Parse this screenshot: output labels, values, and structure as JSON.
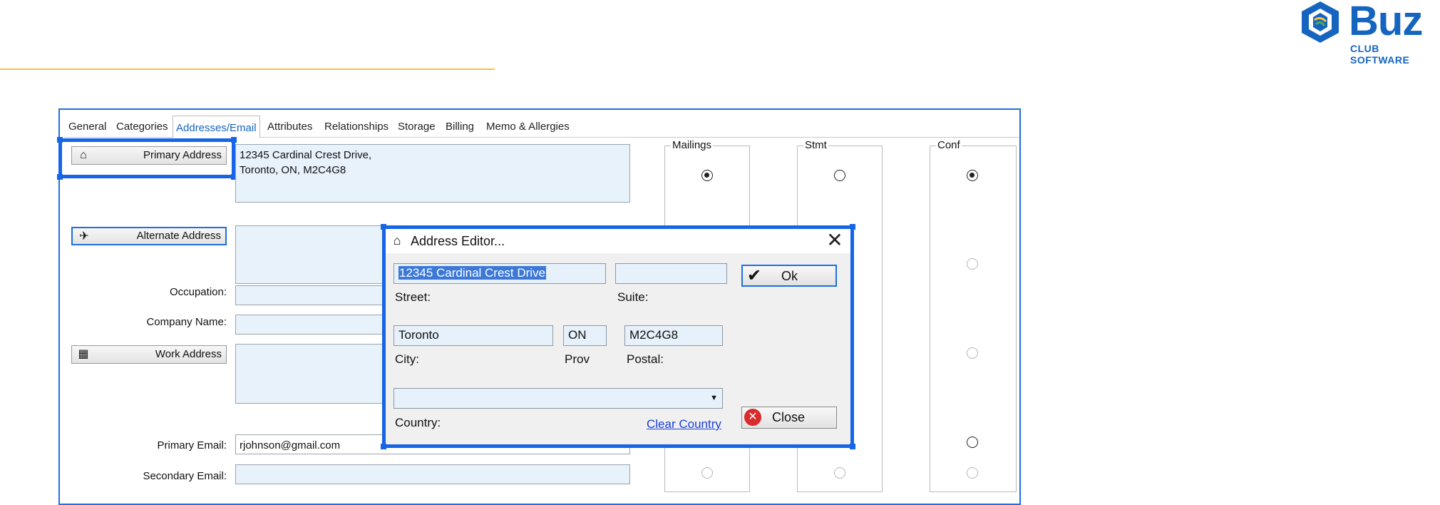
{
  "brand": {
    "logo_text": "Buz",
    "logo_subtext": "CLUB SOFTWARE",
    "accent_color": "#1565c0",
    "rule_color": "#f5c242"
  },
  "tabs": [
    {
      "label": "General"
    },
    {
      "label": "Categories"
    },
    {
      "label": "Addresses/Email",
      "active": true
    },
    {
      "label": "Attributes"
    },
    {
      "label": "Relationships"
    },
    {
      "label": "Storage"
    },
    {
      "label": "Billing"
    },
    {
      "label": "Memo & Allergies"
    }
  ],
  "form": {
    "primary_address_button": "Primary Address",
    "primary_address_line1": "12345 Cardinal Crest Drive,",
    "primary_address_line2": "Toronto, ON, M2C4G8",
    "alternate_address_button": "Alternate Address",
    "occupation_label": "Occupation:",
    "company_name_label": "Company Name:",
    "work_address_button": "Work Address",
    "primary_email_label": "Primary Email:",
    "primary_email_value": "rjohnson@gmail.com",
    "secondary_email_label": "Secondary Email:"
  },
  "groups": {
    "mailings": "Mailings",
    "stmt": "Stmt",
    "conf": "Conf"
  },
  "radios": {
    "primary": {
      "mailings": true,
      "stmt": false,
      "conf": true
    }
  },
  "dialog": {
    "title": "Address Editor...",
    "street_value": "12345 Cardinal Crest Drive",
    "street_label": "Street:",
    "suite_value": "",
    "suite_label": "Suite:",
    "city_value": "Toronto",
    "city_label": "City:",
    "prov_value": "ON",
    "prov_label": "Prov",
    "postal_value": "M2C4G8",
    "postal_label": "Postal:",
    "country_value": "",
    "country_label": "Country:",
    "clear_country_link": "Clear Country",
    "ok_button": "Ok",
    "close_button": "Close"
  },
  "icons": {
    "ok": "checkmark-icon",
    "close": "red-x-icon",
    "dropdown": "chevron-down-icon",
    "window_close": "close-icon"
  }
}
